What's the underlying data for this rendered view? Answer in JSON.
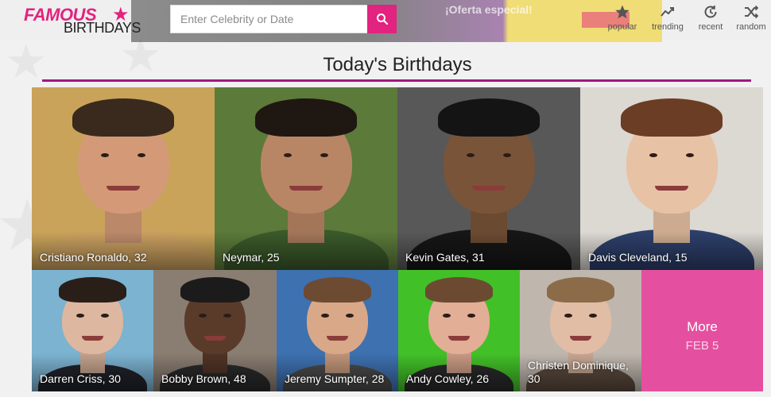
{
  "header": {
    "logo_famous": "FAMOUS",
    "logo_birthdays": "BIRTHDAYS",
    "search_placeholder": "Enter Celebrity or Date",
    "nav": [
      {
        "label": "popular",
        "icon": "star-icon"
      },
      {
        "label": "trending",
        "icon": "trending-icon"
      },
      {
        "label": "recent",
        "icon": "recent-icon"
      },
      {
        "label": "random",
        "icon": "random-icon"
      }
    ],
    "ad_text": "¡Oferta especial!"
  },
  "page_title": "Today's Birthdays",
  "row1": [
    {
      "label": "Cristiano Ronaldo, 32",
      "bg": "#c9a35a",
      "skin": "#d49a78",
      "hair": "#3a2a1e",
      "shirt": "#caa060"
    },
    {
      "label": "Neymar, 25",
      "bg": "#5c7a3a",
      "skin": "#b98665",
      "hair": "#1f1712",
      "shirt": "#3b5a2a"
    },
    {
      "label": "Kevin Gates, 31",
      "bg": "#585858",
      "skin": "#7a5439",
      "hair": "#141414",
      "shirt": "#161616"
    },
    {
      "label": "Davis Cleveland, 15",
      "bg": "#dcd8d2",
      "skin": "#e8c2a4",
      "hair": "#6a3d24",
      "shirt": "#2d3f6b"
    }
  ],
  "row2": [
    {
      "label": "Darren Criss, 30",
      "bg": "#7bb3d1",
      "skin": "#ddb79f",
      "hair": "#2a1e19",
      "shirt": "#20232a"
    },
    {
      "label": "Bobby Brown, 48",
      "bg": "#8a7d72",
      "skin": "#5a3b2a",
      "hair": "#1b1b1b",
      "shirt": "#2a2a2a"
    },
    {
      "label": "Jeremy Sumpter, 28",
      "bg": "#3e71b0",
      "skin": "#d9a888",
      "hair": "#6d4b32",
      "shirt": "#4a4a4a"
    },
    {
      "label": "Andy Cowley, 26",
      "bg": "#42c028",
      "skin": "#e2ae95",
      "hair": "#6b4a31",
      "shirt": "#2a2a2a"
    },
    {
      "label": "Christen Dominique, 30",
      "bg": "#bfb7ae",
      "skin": "#e1bda5",
      "hair": "#8b6b48",
      "shirt": "#5c4a3e"
    }
  ],
  "more": {
    "label": "More",
    "date": "FEB 5"
  }
}
